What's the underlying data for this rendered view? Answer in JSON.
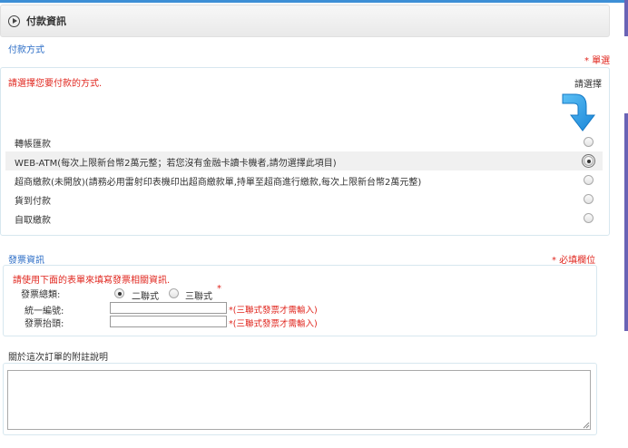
{
  "header": {
    "title": "付款資訊"
  },
  "payment": {
    "section_label": "付款方式",
    "required_note": "* 單選",
    "instruction": "請選擇您要付款的方式.",
    "choose_label": "請選擇",
    "options": [
      {
        "label": "轉帳匯款",
        "selected": false
      },
      {
        "label": "WEB-ATM(每次上限新台幣2萬元整；若您沒有金融卡讀卡機者,請勿選擇此項目)",
        "selected": true
      },
      {
        "label": "超商繳款(未開放)(請務必用雷射印表機印出超商繳款單,持單至超商進行繳款,每次上限新台幣2萬元整)",
        "selected": false
      },
      {
        "label": "貨到付款",
        "selected": false
      },
      {
        "label": "自取繳款",
        "selected": false
      }
    ]
  },
  "invoice": {
    "section_label": "發票資訊",
    "required_note": "* 必填欄位",
    "instruction": "請使用下面的表單來填寫發票相關資訊.",
    "type_label": "發票總類:",
    "type_options": [
      {
        "label": "二聯式",
        "selected": true
      },
      {
        "label": "三聯式",
        "selected": false
      }
    ],
    "type_asterisk": "*",
    "tax_id_label": "統一編號:",
    "tax_id_value": "",
    "tax_id_note": "*(三聯式發票才需輸入)",
    "title_label": "發票抬頭:",
    "title_value": "",
    "title_note": "*(三聯式發票才需輸入)"
  },
  "comments": {
    "label": "關於這次訂單的附註說明",
    "value": ""
  },
  "colors": {
    "accent_blue": "#2a6cc6",
    "required_red": "#e0261e",
    "arrow_blue": "#2e9be6",
    "sidebar_purple": "#6a63b5"
  },
  "icons": {
    "header_icon": "play-circle-icon",
    "arrow": "curved-arrow-down-icon"
  }
}
